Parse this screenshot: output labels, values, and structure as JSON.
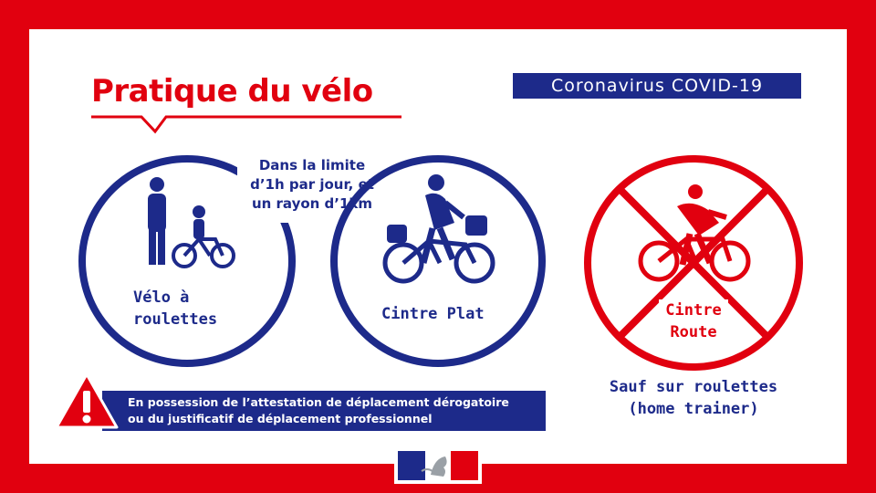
{
  "header": {
    "title": "Pratique du vélo",
    "badge": "Coronavirus COVID-19"
  },
  "note": {
    "limit_text": "Dans la limite\nd’1h par jour, et\nun rayon d’1km"
  },
  "panels": [
    {
      "label": "Vélo à\nroulettes",
      "icon": "parent-child-bike-icon",
      "status": "allowed"
    },
    {
      "label": "Cintre Plat",
      "icon": "flat-bar-cyclist-icon",
      "status": "allowed"
    },
    {
      "label": "Cintre\nRoute",
      "icon": "road-cyclist-icon",
      "status": "forbidden"
    }
  ],
  "exception": {
    "text": "Sauf sur roulettes\n(home trainer)"
  },
  "warning": {
    "icon": "warning-triangle-icon",
    "text": "En possession de l’attestation de déplacement dérogatoire\nou du justificatif de déplacement professionnel"
  },
  "footer": {
    "logo": "marianne-logo-icon"
  },
  "colors": {
    "red": "#e1000f",
    "blue": "#1d2a8a",
    "white": "#ffffff"
  }
}
